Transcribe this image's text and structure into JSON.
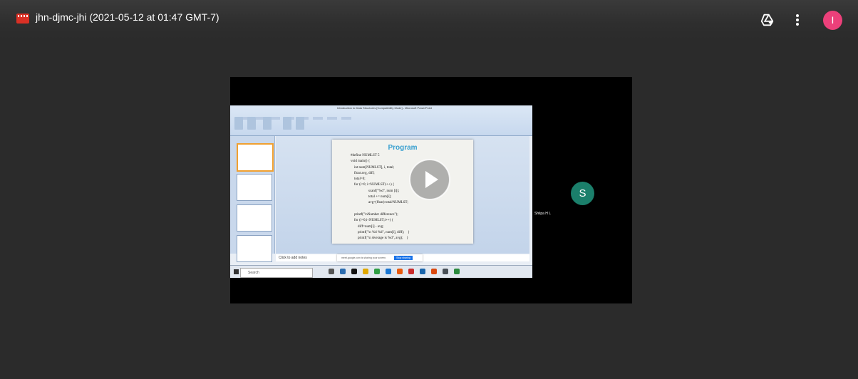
{
  "header": {
    "title": "jhn-djmc-jhi (2021-05-12 at 01:47 GMT-7)",
    "avatar_letter": "I",
    "accent_color": "#ec407a",
    "icons": [
      "video-file-icon",
      "add-to-drive-icon",
      "more-vert-icon"
    ]
  },
  "recording": {
    "ppt_window_title": "Introduction to Data Structures [Compatibility Mode] - Microsoft PowerPoint",
    "slide": {
      "title": "Program",
      "code_lines": [
        "#define NUMLST 5",
        "void main() {",
        "    int num[NUMLST], i, total;",
        "    float avg, diff;",
        "    total=0;",
        "    for (i=0; i<NUMLST;i++) {",
        "                    scanf(\"%d\", num [i]);",
        "                    total += num[i];",
        "                    avg=(float) total/NUMLST;",
        "",
        "    printf(\"\\nNumber difference\");",
        "    for (i=0;i<NUMLST;i++) {",
        "        diff=num[i] - avg;",
        "        printf(\"\\n %d %d\", num[i], diff);    }",
        "        printf(\"\\n Average is %d\", avg);    }"
      ]
    },
    "notes_placeholder": "Click to add notes",
    "share_bar_text": "meet.google.com is sharing your screen.",
    "share_stop_label": "Stop sharing",
    "taskbar_search": "Search"
  },
  "participant": {
    "name": "Shilpa H L",
    "avatar_letter": "S",
    "avatar_color": "#1b7f6b"
  }
}
